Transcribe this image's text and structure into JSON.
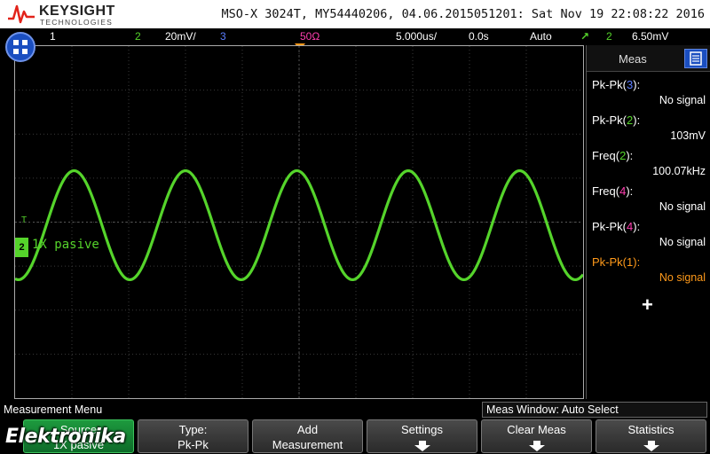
{
  "header": {
    "brand": "KEYSIGHT",
    "brand_sub": "TECHNOLOGIES",
    "device_title": "MSO-X 3024T, MY54440206, 04.06.2015051201: Sat Nov 19 22:08:22 2016"
  },
  "status_bar": {
    "ch1": "1",
    "ch2": "2",
    "ch2_scale": "20mV/",
    "ch3": "3",
    "impedance": "50Ω",
    "timebase": "5.000us/",
    "delay": "0.0s",
    "trigger_mode": "Auto",
    "trigger_channel": "2",
    "trigger_level": "6.50mV"
  },
  "waveform": {
    "channel_marker": "2",
    "channel_label": "1X pasive",
    "trigger_marker": "T",
    "color": "#55d42b",
    "cycles_shown": 5.1,
    "amplitude_divs": 2.03
  },
  "meas_panel": {
    "tab": "Meas",
    "items": [
      {
        "name": "Pk-Pk",
        "channel": "3",
        "value": "No signal",
        "color_class": "c3"
      },
      {
        "name": "Pk-Pk",
        "channel": "2",
        "value": "103mV",
        "color_class": "c2"
      },
      {
        "name": "Freq",
        "channel": "2",
        "value": "100.07kHz",
        "color_class": "c2"
      },
      {
        "name": "Freq",
        "channel": "4",
        "value": "No signal",
        "color_class": "c4"
      },
      {
        "name": "Pk-Pk",
        "channel": "4",
        "value": "No signal",
        "color_class": "c4"
      },
      {
        "name": "Pk-Pk",
        "channel": "1",
        "value": "No signal",
        "color_class": "c1"
      }
    ],
    "add_symbol": "+"
  },
  "menu": {
    "title": "Measurement Menu",
    "meas_window": "Meas Window: Auto Select",
    "softkeys": [
      {
        "l1": "Source",
        "l2": "1X pasive"
      },
      {
        "l1": "Type:",
        "l2": "Pk-Pk"
      },
      {
        "l1": "Add",
        "l2": "Measurement"
      },
      {
        "l1": "Settings",
        "l2": ""
      },
      {
        "l1": "Clear Meas",
        "l2": ""
      },
      {
        "l1": "Statistics",
        "l2": ""
      }
    ]
  },
  "watermark": "Elektronika",
  "colors": {
    "accent_blue": "#1a4ec0",
    "ch1": "#ff9a1a",
    "ch2": "#55d42b",
    "ch3": "#5a7dff",
    "ch4": "#ff3fb0"
  }
}
